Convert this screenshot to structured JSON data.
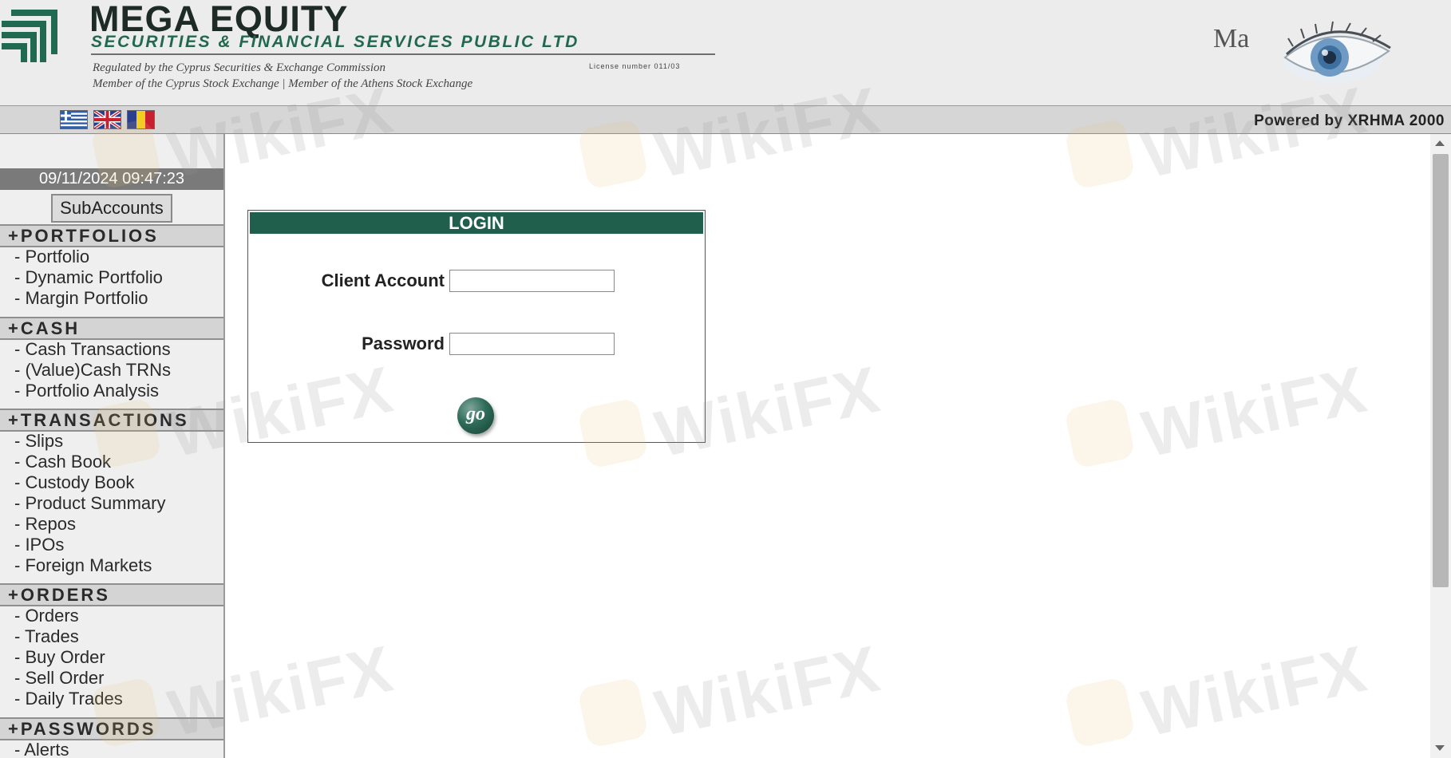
{
  "header": {
    "brand_name": "MEGA EQUITY",
    "brand_subtitle": "SECURITIES & FINANCIAL SERVICES PUBLIC LTD",
    "regulated_text": "Regulated by the Cyprus Securities & Exchange Commission",
    "member_text": "Member of the Cyprus Stock Exchange  |  Member of the Athens Stock Exchange",
    "license_text": "License number 011/03",
    "ma_text": "Ma",
    "logo_icon": "company-logo-icon",
    "eye_icon": "eye-icon"
  },
  "langbar": {
    "flags": [
      "greek-flag-icon",
      "uk-flag-icon",
      "romanian-flag-icon"
    ],
    "powered_by": "Powered by XRHMA 2000"
  },
  "sidebar": {
    "datetime": "09/11/2024 09:47:23",
    "subaccounts_label": "SubAccounts",
    "sections": [
      {
        "title": "+PORTFOLIOS",
        "items": [
          "- Portfolio",
          "- Dynamic Portfolio",
          "- Margin Portfolio"
        ]
      },
      {
        "title": "+CASH",
        "items": [
          "- Cash Transactions",
          "- (Value)Cash TRNs",
          "- Portfolio Analysis"
        ]
      },
      {
        "title": "+TRANSACTIONS",
        "items": [
          "- Slips",
          "- Cash Book",
          "- Custody Book",
          "- Product Summary",
          "- Repos",
          "- IPOs",
          "- Foreign Markets"
        ]
      },
      {
        "title": "+ORDERS",
        "items": [
          "- Orders",
          "- Trades",
          "- Buy Order",
          "- Sell Order",
          "- Daily Trades"
        ]
      },
      {
        "title": "+PASSWORDS",
        "items": [
          "- Alerts"
        ]
      }
    ]
  },
  "login": {
    "title": "LOGIN",
    "client_account_label": "Client Account",
    "client_account_value": "",
    "password_label": "Password",
    "password_value": "",
    "go_label": "go"
  },
  "watermark": "WikiFX",
  "colors": {
    "login_header": "#1f5f4b",
    "brand_green": "#22684e",
    "sidebar_bg": "#efefef",
    "datetime_bg": "#7a7a7a"
  }
}
